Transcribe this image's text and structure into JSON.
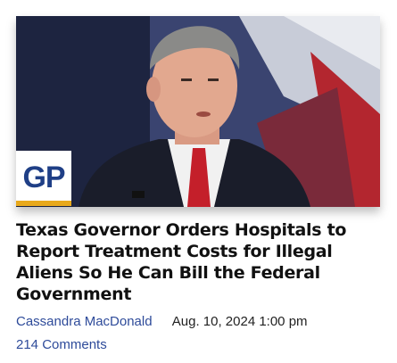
{
  "article": {
    "image_alt": "Texas Governor Greg Abbott speaking",
    "logo_text": "GP",
    "headline": "Texas Governor Orders Hospitals to Report Treatment Costs for Illegal Aliens So He Can Bill the Federal Government",
    "author": "Cassandra MacDonald",
    "date": "Aug. 10, 2024 1:00 pm",
    "comments": "214 Comments"
  },
  "colors": {
    "logo_blue": "#1f3f86",
    "logo_accent": "#e8a91c",
    "link_blue": "#2e4b9a",
    "headline": "#111111"
  }
}
